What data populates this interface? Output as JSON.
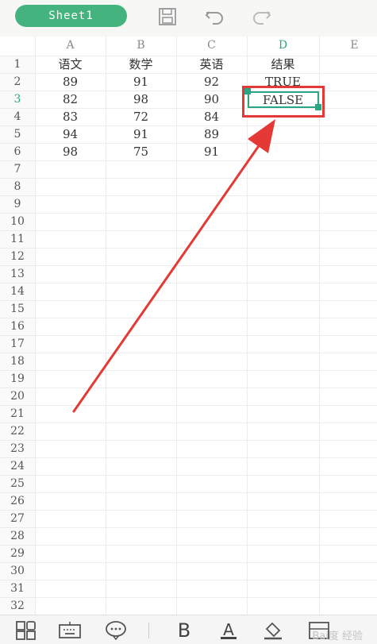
{
  "sheet_tab": {
    "label": "Sheet1"
  },
  "toolbar": {
    "icons": [
      "save-icon",
      "undo-icon",
      "redo-icon"
    ]
  },
  "columns": [
    {
      "letter": "A"
    },
    {
      "letter": "B"
    },
    {
      "letter": "C"
    },
    {
      "letter": "D",
      "active": true
    },
    {
      "letter": "E"
    }
  ],
  "rows": [
    "1",
    "2",
    "3",
    "4",
    "5",
    "6",
    "7",
    "8",
    "9",
    "10",
    "11",
    "12",
    "13",
    "14",
    "15",
    "16",
    "17",
    "18",
    "19",
    "20",
    "21",
    "22",
    "23",
    "24",
    "25",
    "26",
    "27",
    "28",
    "29",
    "30",
    "31",
    "32"
  ],
  "active_row": "3",
  "table": [
    [
      "语文",
      "数学",
      "英语",
      "结果"
    ],
    [
      "89",
      "91",
      "92",
      "TRUE"
    ],
    [
      "82",
      "98",
      "90",
      "FALSE"
    ],
    [
      "83",
      "72",
      "84",
      ""
    ],
    [
      "94",
      "91",
      "89",
      ""
    ],
    [
      "98",
      "75",
      "91",
      ""
    ]
  ],
  "selected_cell": {
    "ref": "D3",
    "value": "FALSE"
  },
  "bottom_toolbar": {
    "icons": [
      "grid-menu-icon",
      "keyboard-icon",
      "bubble-icon",
      "bold-icon",
      "font-color-icon",
      "fill-color-icon",
      "cell-border-icon"
    ],
    "bold_label": "B",
    "font_color_label": "A"
  },
  "watermark": "Bai度 经验",
  "colors": {
    "accent": "#44b37d",
    "selection": "#2aa585",
    "annotation": "#e53935"
  }
}
